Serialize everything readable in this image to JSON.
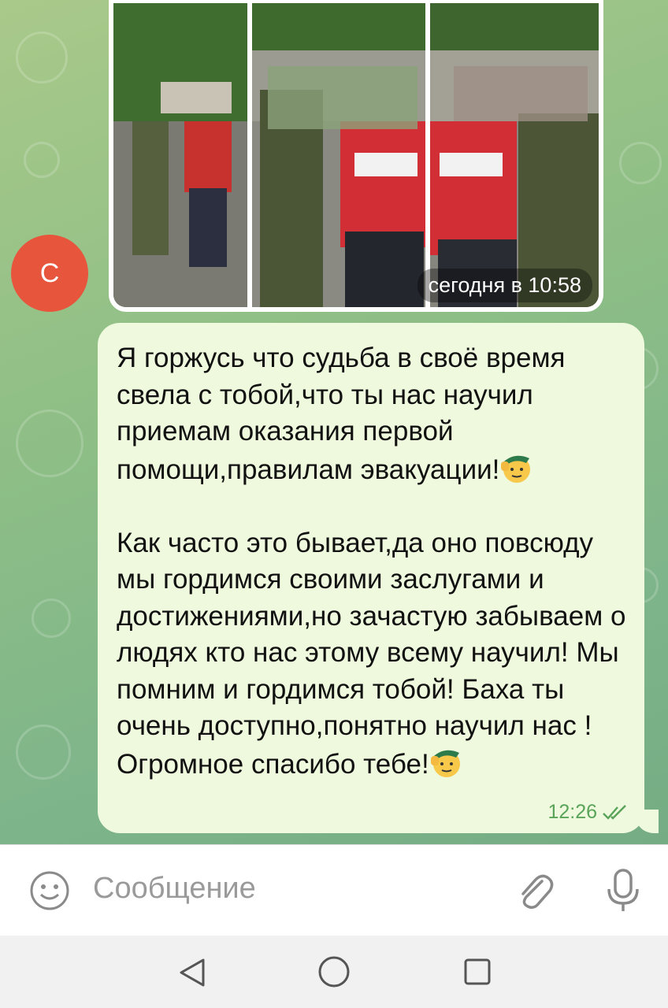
{
  "chat": {
    "avatar_letter": "С",
    "album": {
      "time_label": "сегодня в 10:58",
      "photos": [
        {
          "id": "photo-1",
          "icon": "photo-icon"
        },
        {
          "id": "photo-2",
          "icon": "photo-icon"
        },
        {
          "id": "photo-3",
          "icon": "photo-icon"
        }
      ]
    },
    "message": {
      "paragraph1": "Я горжусь что судьба в своё время свела с тобой,что ты нас научил приемам оказания первой помощи,правилам эвакуации!",
      "paragraph2": "Как часто это бывает,да оно повсюду мы гордимся своими заслугами и достижениями,но зачастую забываем о людях кто нас этому всему научил! Мы помним и гордимся тобой! Баха ты очень доступно,понятно научил нас ! Огромное спасибо тебе!",
      "emoji": "saluting-face-icon",
      "time": "12:26",
      "status_icon": "double-check-icon"
    }
  },
  "composer": {
    "placeholder": "Сообщение",
    "emoji_icon": "smiley-icon",
    "attach_icon": "paperclip-icon",
    "mic_icon": "microphone-icon"
  },
  "navbar": {
    "back_icon": "triangle-back-icon",
    "home_icon": "circle-home-icon",
    "recent_icon": "square-recents-icon"
  },
  "colors": {
    "bubble": "#eef9dd",
    "avatar": "#e8553d",
    "check": "#5aa45a"
  }
}
